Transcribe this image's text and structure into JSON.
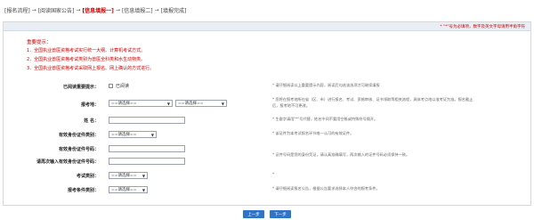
{
  "breadcrumb": [
    {
      "label": "[报名流程]",
      "active": false
    },
    {
      "label": "[阅读国家公告]",
      "active": false
    },
    {
      "label": "[信息填报一]",
      "active": true
    },
    {
      "label": "[信息填报二]",
      "active": false
    },
    {
      "label": "[填报完成]",
      "active": false
    }
  ],
  "arrow": "→",
  "header_note": "* \"*\"号为必填项，数字及英文字母请用半角字符",
  "important": {
    "title": "重要提示：",
    "items": [
      "1．全国执业兽医资格考试实行统一大纲、计算机考试方式。",
      "2．全国执业兽医资格考试类别为兽医全科类和水生动物类。",
      "3．全国执业兽医资格考试采取网上报名、网上确认的方式进行。"
    ]
  },
  "form": {
    "read_label": "已阅读重要提示：",
    "read_option": "已阅读",
    "read_help": "* 请仔细阅读以上重要提示内容，阅读后勾选该选项才可继续填报",
    "region_label": "报考地：",
    "region_select1": "==请选择==",
    "region_select2": "==请选择==",
    "region_help_line1": "* 您将在报考地所在省（区、市）进行报名、考试、资格审核、证书领取等相关流程，具体考点地以准考证为准。报名截止",
    "region_help_line2": "后，报考地不可更改。",
    "name_label": "姓 名：",
    "name_value": "",
    "name_help": "* 生僻字请用\"*\"号代替，姓名中间不要用空格或特殊符号隔开。",
    "id_type_label": "有效身份证件类别：",
    "id_type_value": "==请选择==",
    "id_type_help": "* 该证件为本考试报名环节唯一认可的有效证件。",
    "id_no_label": "有效身份证件号码：",
    "id_no_value": "",
    "id_no2_label": "请再次输入有效身份证件号码：",
    "id_no2_value": "",
    "id_no_help": "* 证件号码是您的身份凭证，请认真准确填写，两次输入的证件号码必须保持一致。",
    "exam_type_label": "考试类别：",
    "exam_type_value": "==请选择==",
    "exam_type_help": "*",
    "cond_label": "报考条件类别：",
    "cond_value": "==请选择==",
    "cond_help": "* 请仔细阅读报名公告，根据公告要求选择本人符合的报考条件。"
  },
  "buttons": {
    "prev": "上一步",
    "next": "下一步"
  }
}
